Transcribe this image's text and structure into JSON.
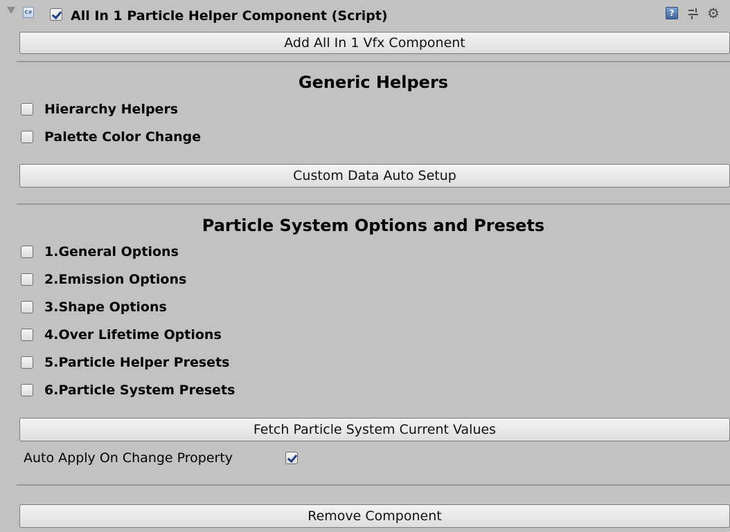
{
  "header": {
    "script_icon_text": "C#",
    "title": "All In 1 Particle Helper Component (Script)",
    "enabled": true,
    "help_icon_text": "?"
  },
  "buttons": {
    "add_vfx": "Add All In 1 Vfx Component",
    "custom_data": "Custom Data Auto Setup",
    "fetch_values": "Fetch Particle System Current Values",
    "remove": "Remove Component"
  },
  "generic_helpers": {
    "title": "Generic Helpers",
    "toggles": [
      {
        "label": "Hierarchy Helpers",
        "checked": false
      },
      {
        "label": "Palette Color Change",
        "checked": false
      }
    ]
  },
  "particle_options": {
    "title": "Particle System Options and Presets",
    "toggles": [
      {
        "label": "1.General Options",
        "checked": false
      },
      {
        "label": "2.Emission Options",
        "checked": false
      },
      {
        "label": "3.Shape Options",
        "checked": false
      },
      {
        "label": "4.Over Lifetime Options",
        "checked": false
      },
      {
        "label": "5.Particle Helper Presets",
        "checked": false
      },
      {
        "label": "6.Particle System Presets",
        "checked": false
      }
    ]
  },
  "auto_apply": {
    "label": "Auto Apply On Change Property",
    "checked": true
  },
  "icons": {
    "foldout": "triangle-down-icon",
    "script": "csharp-script-icon",
    "help": "help-book-icon",
    "presets": "presets-sliders-icon",
    "settings": "gear-icon"
  },
  "colors": {
    "panel_bg": "#c2c2c2",
    "check_mark": "#1f3f8c"
  }
}
